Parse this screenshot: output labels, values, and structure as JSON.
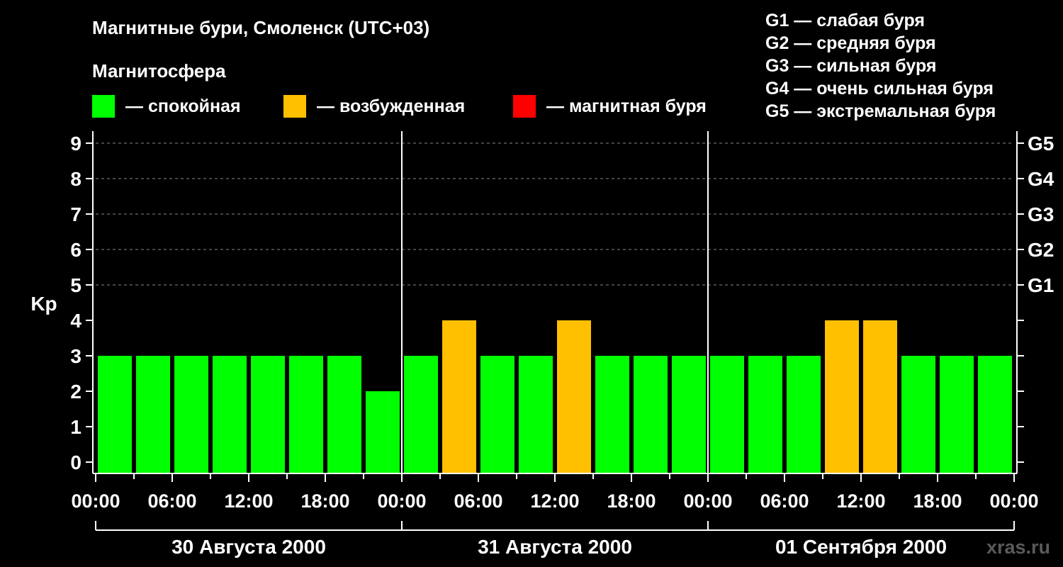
{
  "title": "Магнитные бури, Смоленск (UTC+03)",
  "subtitle": "Магнитосфера",
  "legend": [
    {
      "color": "#00ff00",
      "label": "— спокойная"
    },
    {
      "color": "#ffc000",
      "label": "— возбужденная"
    },
    {
      "color": "#ff0000",
      "label": "— магнитная буря"
    }
  ],
  "storm_scale": [
    "G1 — слабая буря",
    "G2 — средняя буря",
    "G3 — сильная буря",
    "G4 — очень сильная буря",
    "G5 — экстремальная буря"
  ],
  "watermark": "xras.ru",
  "chart_data": {
    "type": "bar",
    "ylabel": "Kp",
    "ylim": [
      0,
      9
    ],
    "yticks": [
      "0",
      "1",
      "2",
      "3",
      "4",
      "5",
      "6",
      "7",
      "8",
      "9"
    ],
    "right_ticks": [
      {
        "value": 5,
        "label": "G1"
      },
      {
        "value": 6,
        "label": "G2"
      },
      {
        "value": 7,
        "label": "G3"
      },
      {
        "value": 8,
        "label": "G4"
      },
      {
        "value": 9,
        "label": "G5"
      }
    ],
    "xtick_labels": [
      "00:00",
      "06:00",
      "12:00",
      "18:00",
      "00:00",
      "06:00",
      "12:00",
      "18:00",
      "00:00",
      "06:00",
      "12:00",
      "18:00",
      "00:00"
    ],
    "days": [
      "30 Августа 2000",
      "31 Августа 2000",
      "01 Сентября 2000"
    ],
    "interval_hours": 3,
    "values": [
      3,
      3,
      3,
      3,
      3,
      3,
      3,
      2,
      3,
      4,
      3,
      3,
      4,
      3,
      3,
      3,
      3,
      3,
      3,
      4,
      4,
      3,
      3,
      3
    ],
    "colors": [
      "#00ff00",
      "#00ff00",
      "#00ff00",
      "#00ff00",
      "#00ff00",
      "#00ff00",
      "#00ff00",
      "#00ff00",
      "#00ff00",
      "#ffc000",
      "#00ff00",
      "#00ff00",
      "#ffc000",
      "#00ff00",
      "#00ff00",
      "#00ff00",
      "#00ff00",
      "#00ff00",
      "#00ff00",
      "#ffc000",
      "#ffc000",
      "#00ff00",
      "#00ff00",
      "#00ff00"
    ],
    "grid": true
  }
}
